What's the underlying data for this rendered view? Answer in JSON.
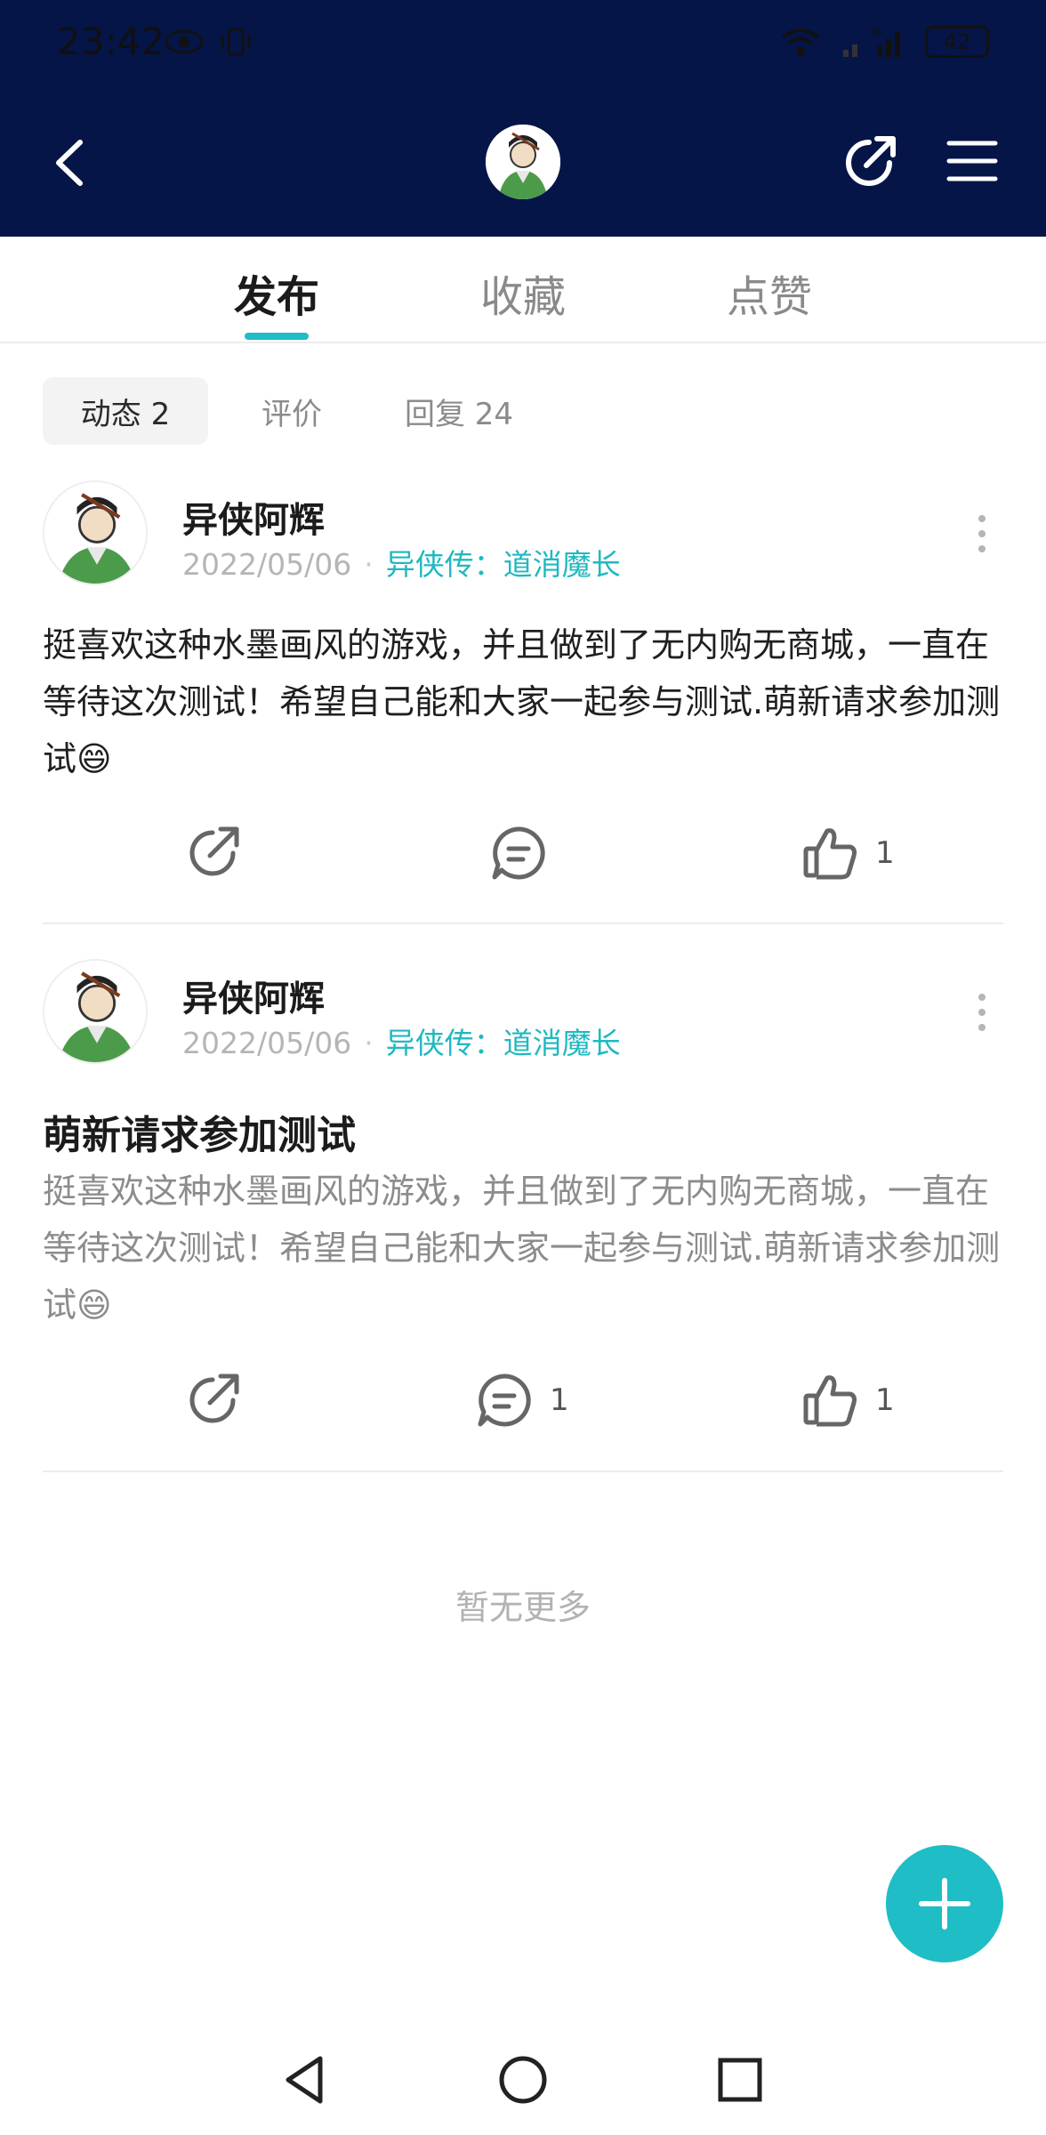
{
  "status_bar": {
    "time": "23:42",
    "battery": "42",
    "network": "5G"
  },
  "header": {
    "back_icon": "chevron-left-icon",
    "share_icon": "share-icon",
    "menu_icon": "hamburger-menu-icon",
    "background_color": "#051548"
  },
  "main_tabs": [
    {
      "label": "发布",
      "active": true
    },
    {
      "label": "收藏",
      "active": false
    },
    {
      "label": "点赞",
      "active": false
    }
  ],
  "sub_tabs": [
    {
      "label": "动态 2",
      "active": true
    },
    {
      "label": "评价",
      "active": false
    },
    {
      "label": "回复 24",
      "active": false
    }
  ],
  "posts": [
    {
      "username": "异侠阿辉",
      "date": "2022/05/06",
      "game": "异侠传：道消魔长",
      "title": "",
      "body": "挺喜欢这种水墨画风的游戏，并且做到了无内购无商城，一直在等待这次测试！希望自己能和大家一起参与测试.萌新请求参加测试😄",
      "comment_count": "",
      "like_count": "1"
    },
    {
      "username": "异侠阿辉",
      "date": "2022/05/06",
      "game": "异侠传：道消魔长",
      "title": "萌新请求参加测试",
      "body": "挺喜欢这种水墨画风的游戏，并且做到了无内购无商城，一直在等待这次测试！希望自己能和大家一起参与测试.萌新请求参加测试😄",
      "comment_count": "1",
      "like_count": "1"
    }
  ],
  "no_more_text": "暂无更多",
  "colors": {
    "accent": "#1fbdc6",
    "header_bg": "#051548",
    "meta_gray": "#b5b5b5"
  }
}
